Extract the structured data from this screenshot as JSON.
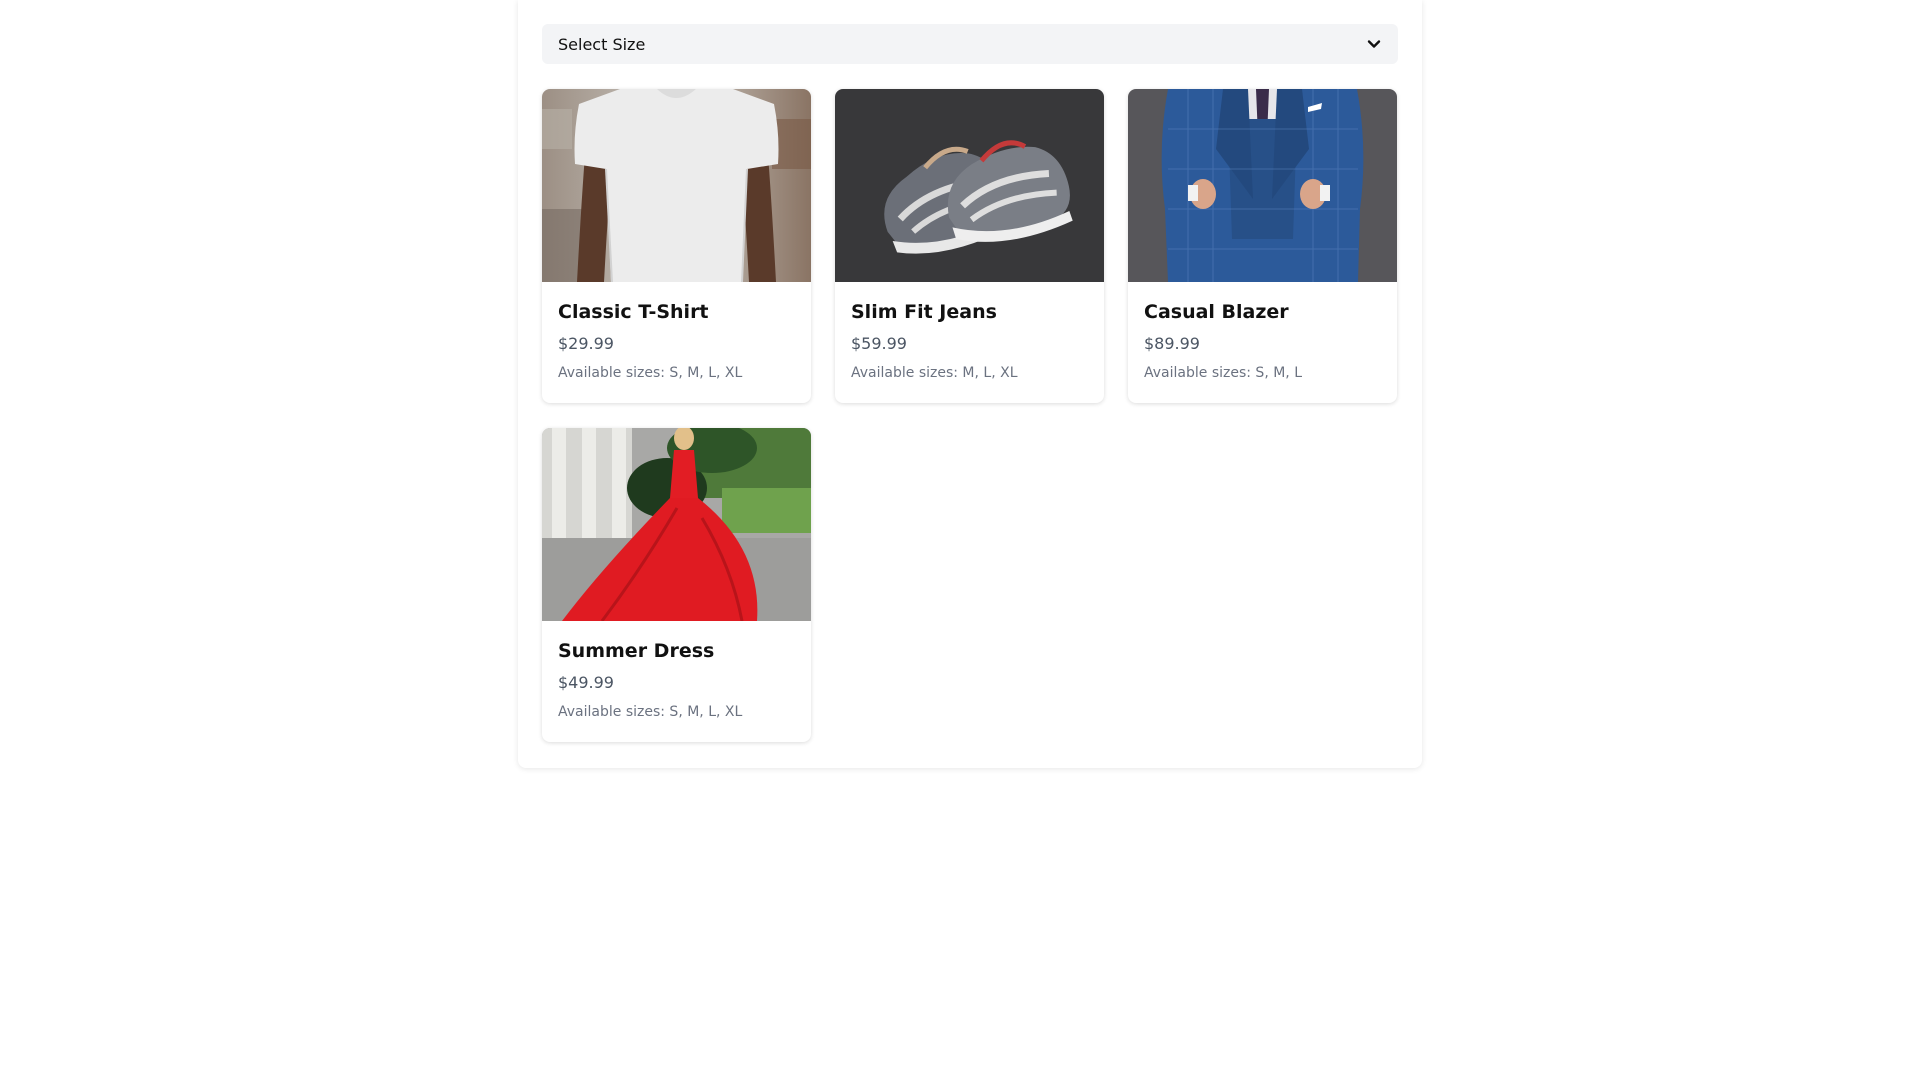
{
  "filter": {
    "select_label": "Select Size",
    "icon": "chevron-down-icon"
  },
  "products": [
    {
      "name": "Classic T-Shirt",
      "price": "$29.99",
      "sizes": "Available sizes: S, M, L, XL",
      "image": "white-tshirt-photo"
    },
    {
      "name": "Slim Fit Jeans",
      "price": "$59.99",
      "sizes": "Available sizes: M, L, XL",
      "image": "sneakers-photo"
    },
    {
      "name": "Casual Blazer",
      "price": "$89.99",
      "sizes": "Available sizes: S, M, L",
      "image": "blue-suit-photo"
    },
    {
      "name": "Summer Dress",
      "price": "$49.99",
      "sizes": "Available sizes: S, M, L, XL",
      "image": "red-dress-photo"
    }
  ],
  "colors": {
    "select_bg": "#f3f4f6",
    "price_text": "#4b5563",
    "sizes_text": "#6b7280"
  }
}
